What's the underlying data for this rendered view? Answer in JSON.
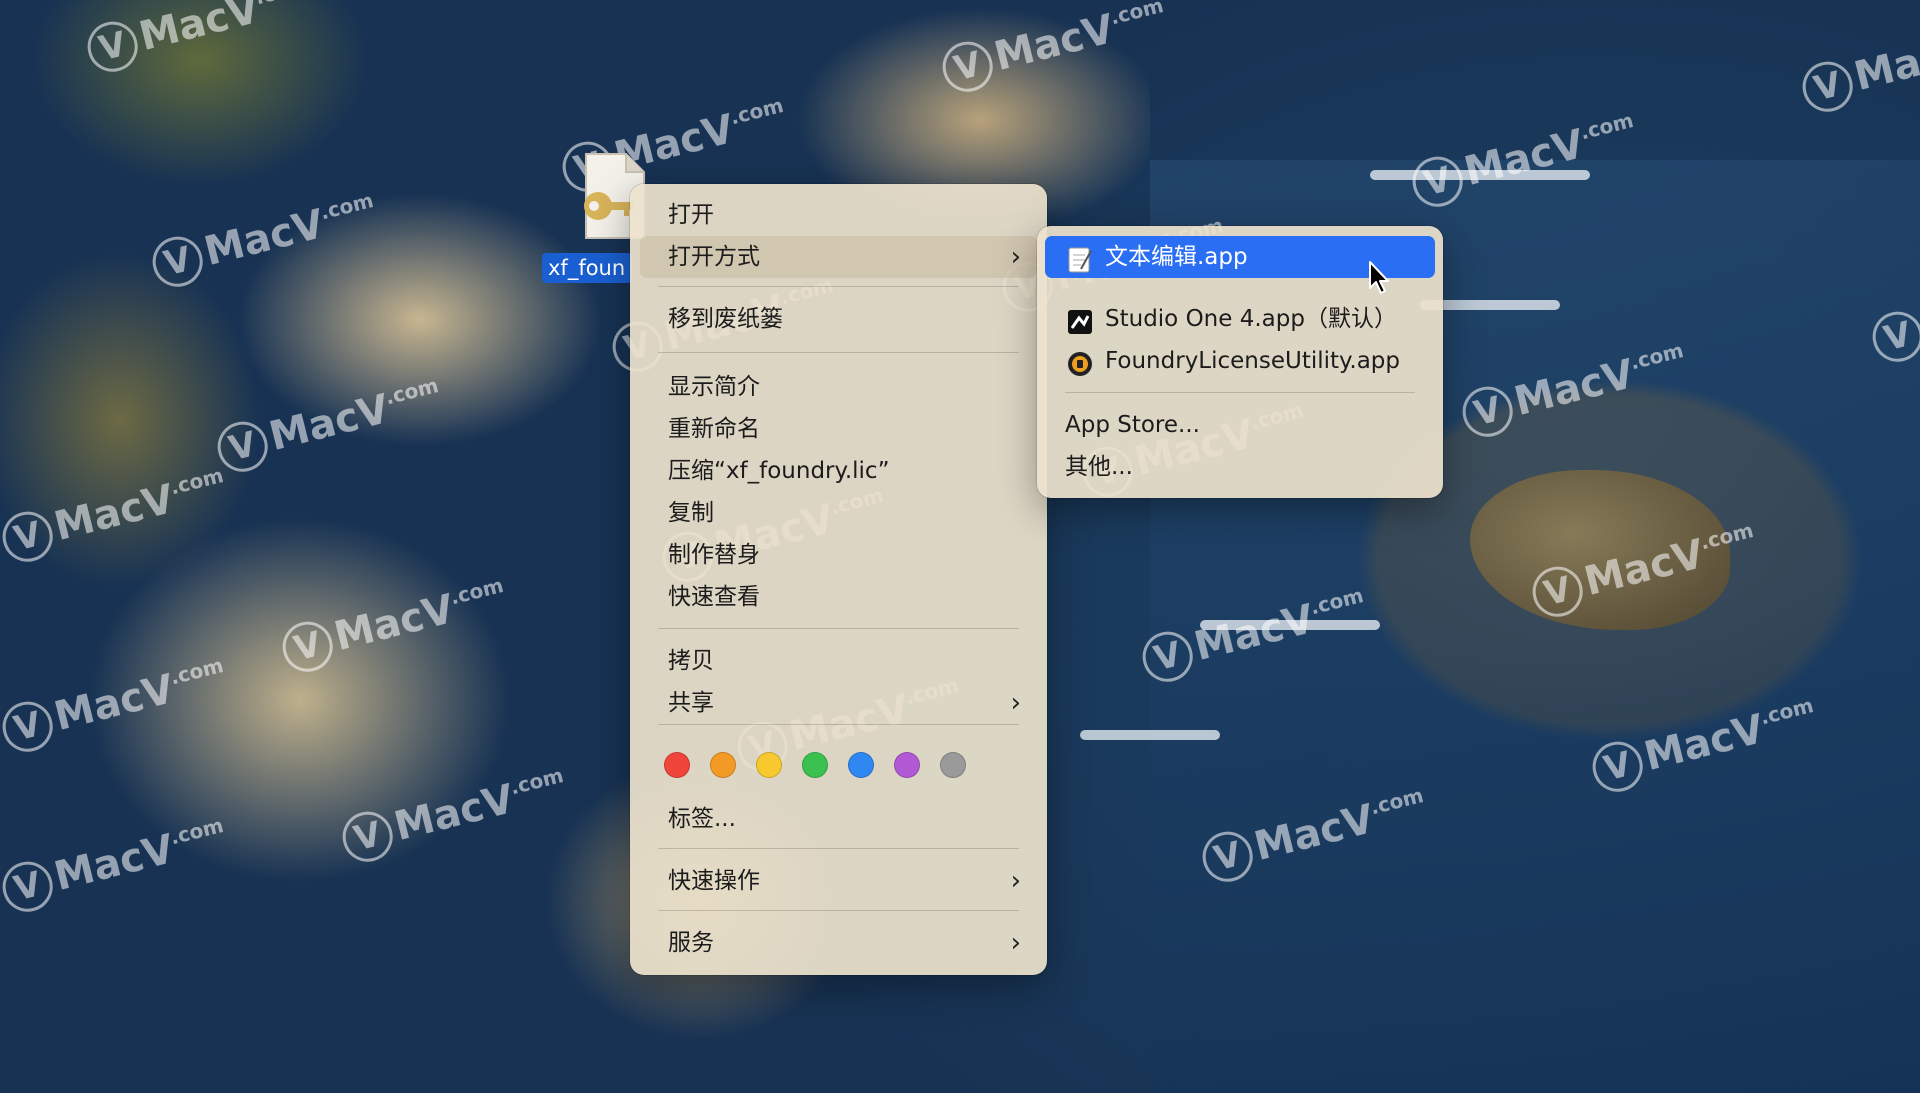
{
  "desktop": {
    "file_name": "xf_foundry.lic",
    "file_label_visible": "xf_foun",
    "watermark_text": "MacV",
    "watermark_com": ".com"
  },
  "context_menu": {
    "items": [
      {
        "label": "打开",
        "submenu": false
      },
      {
        "label": "打开方式",
        "submenu": true,
        "highlighted": true
      },
      {
        "label": "移到废纸篓",
        "submenu": false
      },
      {
        "label": "显示简介",
        "submenu": false
      },
      {
        "label": "重新命名",
        "submenu": false
      },
      {
        "label": "压缩“xf_foundry.lic”",
        "submenu": false
      },
      {
        "label": "复制",
        "submenu": false
      },
      {
        "label": "制作替身",
        "submenu": false
      },
      {
        "label": "快速查看",
        "submenu": false
      },
      {
        "label": "拷贝",
        "submenu": false
      },
      {
        "label": "共享",
        "submenu": true
      },
      {
        "label": "标签...",
        "submenu": false
      },
      {
        "label": "快速操作",
        "submenu": true
      },
      {
        "label": "服务",
        "submenu": true
      }
    ],
    "tag_colors": [
      {
        "name": "red",
        "color": "#f0453a"
      },
      {
        "name": "orange",
        "color": "#f39a26"
      },
      {
        "name": "yellow",
        "color": "#f7c92e"
      },
      {
        "name": "green",
        "color": "#3ac150"
      },
      {
        "name": "blue",
        "color": "#2f87f2"
      },
      {
        "name": "purple",
        "color": "#b25ad6"
      },
      {
        "name": "gray",
        "color": "#9a9a9a"
      }
    ],
    "chevron": "›"
  },
  "open_with_submenu": {
    "apps": [
      {
        "label": "文本编辑.app",
        "selected": true,
        "icon": "textedit-icon"
      },
      {
        "label": "Studio One 4.app（默认）",
        "selected": false,
        "icon": "studio-one-icon"
      },
      {
        "label": "FoundryLicenseUtility.app",
        "selected": false,
        "icon": "foundry-icon"
      }
    ],
    "other": [
      {
        "label": "App Store..."
      },
      {
        "label": "其他..."
      }
    ]
  },
  "colors": {
    "selection_blue": "#2a6ef3",
    "menu_background": "#ece2cc"
  }
}
